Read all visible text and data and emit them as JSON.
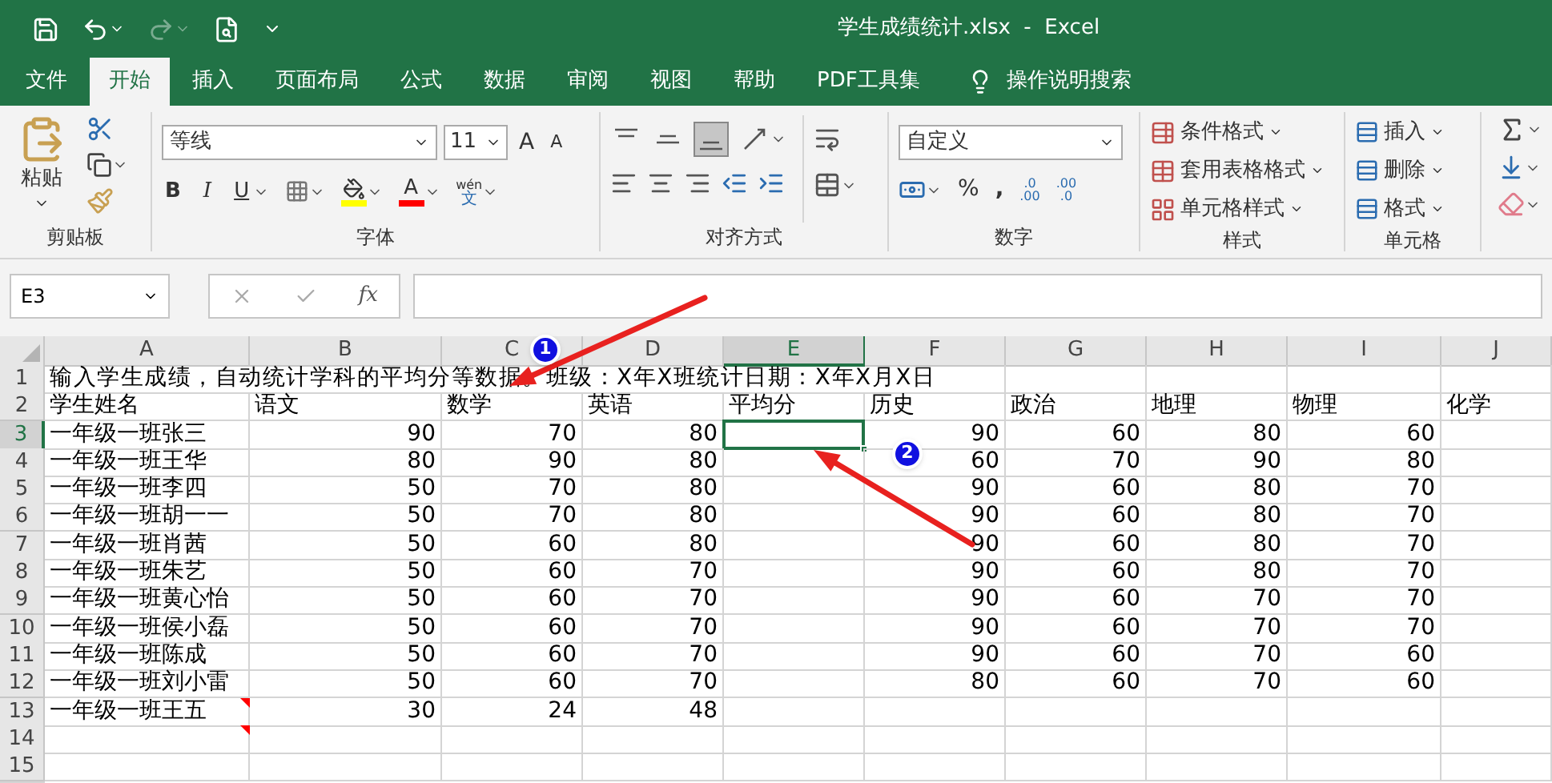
{
  "window": {
    "title": "学生成绩统计.xlsx  -  Excel"
  },
  "tabs": [
    {
      "label": "文件",
      "selected": false
    },
    {
      "label": "开始",
      "selected": true
    },
    {
      "label": "插入",
      "selected": false
    },
    {
      "label": "页面布局",
      "selected": false
    },
    {
      "label": "公式",
      "selected": false
    },
    {
      "label": "数据",
      "selected": false
    },
    {
      "label": "审阅",
      "selected": false
    },
    {
      "label": "视图",
      "selected": false
    },
    {
      "label": "帮助",
      "selected": false
    },
    {
      "label": "PDF工具集",
      "selected": false
    }
  ],
  "tell_me": "操作说明搜索",
  "ribbon": {
    "clipboard": {
      "label": "剪贴板",
      "paste": "粘贴"
    },
    "font": {
      "label": "字体",
      "font_name": "等线",
      "font_size": "11",
      "grow": "A",
      "shrink": "A",
      "bold": "B",
      "italic": "I",
      "underline": "U",
      "font_color": "A",
      "phonetic_top": "wén",
      "phonetic_bottom": "文"
    },
    "alignment": {
      "label": "对齐方式"
    },
    "number": {
      "label": "数字",
      "format": "自定义",
      "percent": "%",
      "comma": ",",
      "increase_decimal": [
        ".0",
        ".00"
      ],
      "decrease_decimal": [
        ".00",
        ".0"
      ]
    },
    "styles": {
      "label": "样式",
      "items": [
        "条件格式",
        "套用表格格式",
        "单元格样式"
      ]
    },
    "cells": {
      "label": "单元格",
      "items": [
        "插入",
        "删除",
        "格式"
      ]
    }
  },
  "formula_bar": {
    "name_box": "E3",
    "fx": "fx"
  },
  "columns": [
    {
      "letter": "A",
      "selected": false
    },
    {
      "letter": "B",
      "selected": false
    },
    {
      "letter": "C",
      "selected": false
    },
    {
      "letter": "D",
      "selected": false
    },
    {
      "letter": "E",
      "selected": true
    },
    {
      "letter": "F",
      "selected": false
    },
    {
      "letter": "G",
      "selected": false
    },
    {
      "letter": "H",
      "selected": false
    },
    {
      "letter": "I",
      "selected": false
    },
    {
      "letter": "J",
      "selected": false
    }
  ],
  "rows": [
    {
      "number": "1",
      "kind": "title",
      "selected": false,
      "comment": false,
      "cells": {
        "A": "输入学生成绩，自动统计学科的平均分等数据。班级：X年X班统计日期：X年X月X日"
      }
    },
    {
      "number": "2",
      "kind": "header",
      "selected": false,
      "comment": false,
      "cells": {
        "A": "学生姓名",
        "B": "语文",
        "C": "数学",
        "D": "英语",
        "E": "平均分",
        "F": "历史",
        "G": "政治",
        "H": "地理",
        "I": "物理",
        "J": "化学"
      }
    },
    {
      "number": "3",
      "kind": "scores",
      "selected": true,
      "comment": false,
      "cells": {
        "A": "一年级一班张三",
        "B": "90",
        "C": "70",
        "D": "80",
        "F": "90",
        "G": "60",
        "H": "80",
        "I": "60"
      }
    },
    {
      "number": "4",
      "kind": "scores",
      "selected": false,
      "comment": false,
      "cells": {
        "A": "一年级一班王华",
        "B": "80",
        "C": "90",
        "D": "80",
        "F": "60",
        "G": "70",
        "H": "90",
        "I": "80"
      }
    },
    {
      "number": "5",
      "kind": "scores",
      "selected": false,
      "comment": false,
      "cells": {
        "A": "一年级一班李四",
        "B": "50",
        "C": "70",
        "D": "80",
        "F": "90",
        "G": "60",
        "H": "80",
        "I": "70"
      }
    },
    {
      "number": "6",
      "kind": "scores",
      "selected": false,
      "comment": false,
      "cells": {
        "A": "一年级一班胡一一",
        "B": "50",
        "C": "70",
        "D": "80",
        "F": "90",
        "G": "60",
        "H": "80",
        "I": "70"
      }
    },
    {
      "number": "7",
      "kind": "scores",
      "selected": false,
      "comment": false,
      "cells": {
        "A": "一年级一班肖茜",
        "B": "50",
        "C": "60",
        "D": "80",
        "F": "90",
        "G": "60",
        "H": "80",
        "I": "70"
      }
    },
    {
      "number": "8",
      "kind": "scores",
      "selected": false,
      "comment": false,
      "cells": {
        "A": "一年级一班朱艺",
        "B": "50",
        "C": "60",
        "D": "70",
        "F": "90",
        "G": "60",
        "H": "80",
        "I": "70"
      }
    },
    {
      "number": "9",
      "kind": "scores",
      "selected": false,
      "comment": false,
      "cells": {
        "A": "一年级一班黄心怡",
        "B": "50",
        "C": "60",
        "D": "70",
        "F": "90",
        "G": "60",
        "H": "70",
        "I": "70"
      }
    },
    {
      "number": "10",
      "kind": "scores",
      "selected": false,
      "comment": false,
      "cells": {
        "A": "一年级一班侯小磊",
        "B": "50",
        "C": "60",
        "D": "70",
        "F": "90",
        "G": "60",
        "H": "70",
        "I": "70"
      }
    },
    {
      "number": "11",
      "kind": "scores",
      "selected": false,
      "comment": false,
      "cells": {
        "A": "一年级一班陈成",
        "B": "50",
        "C": "60",
        "D": "70",
        "F": "90",
        "G": "60",
        "H": "70",
        "I": "60"
      }
    },
    {
      "number": "12",
      "kind": "scores",
      "selected": false,
      "comment": false,
      "cells": {
        "A": "一年级一班刘小雷",
        "B": "50",
        "C": "60",
        "D": "70",
        "F": "80",
        "G": "60",
        "H": "70",
        "I": "60"
      }
    },
    {
      "number": "13",
      "kind": "scores",
      "selected": false,
      "comment": true,
      "cells": {
        "A": "一年级一班王五",
        "B": "30",
        "C": "24",
        "D": "48"
      }
    },
    {
      "number": "14",
      "kind": "scores",
      "selected": false,
      "comment": true,
      "cells": {}
    },
    {
      "number": "15",
      "kind": "scores",
      "selected": false,
      "comment": false,
      "cells": {}
    }
  ],
  "annotations": [
    {
      "label": "1"
    },
    {
      "label": "2"
    }
  ]
}
